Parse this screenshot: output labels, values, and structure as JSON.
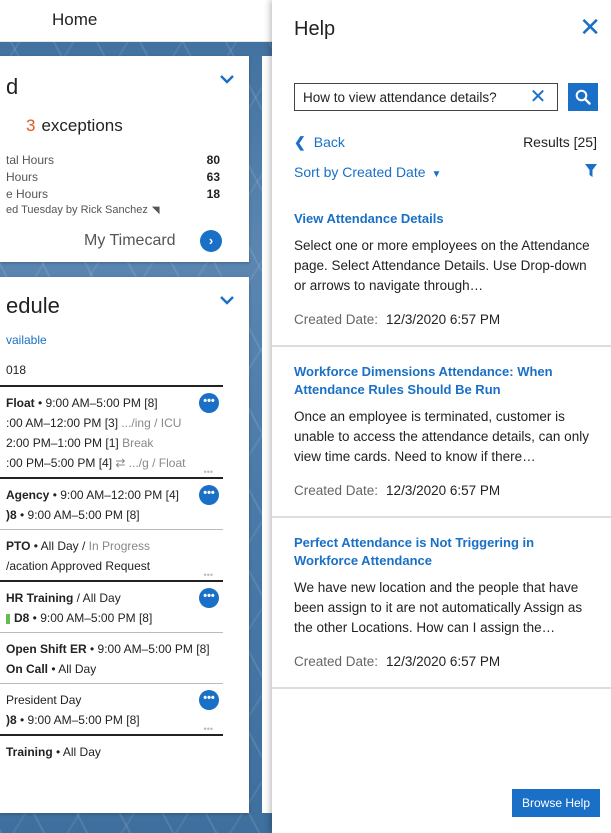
{
  "home": {
    "title": "Home",
    "timecard": {
      "heading": "d",
      "exceptions_count": "3",
      "exceptions_label": "exceptions",
      "hours": [
        {
          "label": "tal Hours",
          "value": "80"
        },
        {
          "label": "Hours",
          "value": "63"
        },
        {
          "label": "e Hours",
          "value": "18"
        }
      ],
      "signed": "ed Tuesday by Rick Sanchez",
      "link": "My Timecard"
    },
    "schedule": {
      "heading": "edule",
      "available": "vailable",
      "date": "018",
      "shifts": [
        {
          "lines": [
            [
              {
                "t": "Float",
                "b": true
              },
              {
                "t": " • 9:00 AM–5:00 PM [8]"
              }
            ],
            [
              {
                "t": ":00 AM–12:00 PM [3] "
              },
              {
                "t": ".../ing / ICU",
                "g": true
              }
            ],
            [
              {
                "t": " 2:00 PM–1:00 PM [1] "
              },
              {
                "t": "Break",
                "g": true
              }
            ],
            [
              {
                "t": ":00 PM–5:00 PM [4] "
              },
              {
                "t": "⇄ .../g / Float",
                "g": true
              }
            ]
          ],
          "more": true,
          "dots": true,
          "strong": true
        },
        {
          "lines": [
            [
              {
                "t": "Agency",
                "b": true
              },
              {
                "t": " • 9:00 AM–12:00 PM [4]"
              }
            ],
            [
              {
                "t": ")8",
                "b": true
              },
              {
                "t": " • 9:00 AM–5:00 PM [8]"
              }
            ]
          ],
          "more": true,
          "dots": false,
          "strong": true
        },
        {
          "lines": [
            [
              {
                "t": "PTO",
                "b": true
              },
              {
                "t": " • All Day / "
              },
              {
                "t": "In Progress",
                "g": true
              }
            ],
            [
              {
                "t": "/acation Approved Request"
              }
            ]
          ],
          "more": false,
          "dots": true,
          "strong": false
        },
        {
          "lines": [
            [
              {
                "t": "HR Training",
                "b": true
              },
              {
                "t": " / All Day"
              }
            ],
            [
              {
                "t": "D8",
                "b": true,
                "green": true
              },
              {
                "t": " • 9:00 AM–5:00 PM [8]"
              }
            ]
          ],
          "more": true,
          "dots": false,
          "strong": true
        },
        {
          "lines": [
            [
              {
                "t": "Open Shift ER",
                "b": true
              },
              {
                "t": " • 9:00 AM–5:00 PM [8]"
              }
            ],
            [
              {
                "t": "On Call",
                "b": true
              },
              {
                "t": " • All Day"
              }
            ]
          ],
          "more": false,
          "dots": false,
          "strong": false
        },
        {
          "lines": [
            [
              {
                "t": "President Day"
              }
            ],
            [
              {
                "t": ")8",
                "b": true
              },
              {
                "t": " • 9:00 AM–5:00 PM [8]"
              }
            ]
          ],
          "more": true,
          "dots": true,
          "strong": false
        },
        {
          "lines": [
            [
              {
                "t": "Training",
                "b": true
              },
              {
                "t": " • All Day"
              }
            ]
          ],
          "more": false,
          "dots": false,
          "strong": true
        }
      ]
    }
  },
  "help": {
    "title": "Help",
    "search_value": "How to view attendance details?",
    "back_label": "Back",
    "results_label": "Results [25]",
    "sort_label": "Sort by Created Date",
    "results": [
      {
        "title": "View Attendance Details",
        "body": "Select one or more employees on the Attendance page. Select Attendance Details. Use Drop-down or arrows to navigate through…",
        "date_label": "Created Date:",
        "date_value": "12/3/2020 6:57 PM"
      },
      {
        "title": "Workforce Dimensions Attendance: When Attendance Rules Should Be Run",
        "body": "Once an employee is terminated, customer is unable to access the attendance details, can only view time cards. Need to know if there…",
        "date_label": "Created Date:",
        "date_value": "12/3/2020 6:57 PM"
      },
      {
        "title": "Perfect Attendance is Not Triggering in Workforce Attendance",
        "body": "We have new location and the people that have been assign to it are not automatically Assign as the other Locations. How can I assign the…",
        "date_label": "Created Date:",
        "date_value": "12/3/2020 6:57 PM"
      }
    ],
    "browse_label": "Browse Help"
  }
}
